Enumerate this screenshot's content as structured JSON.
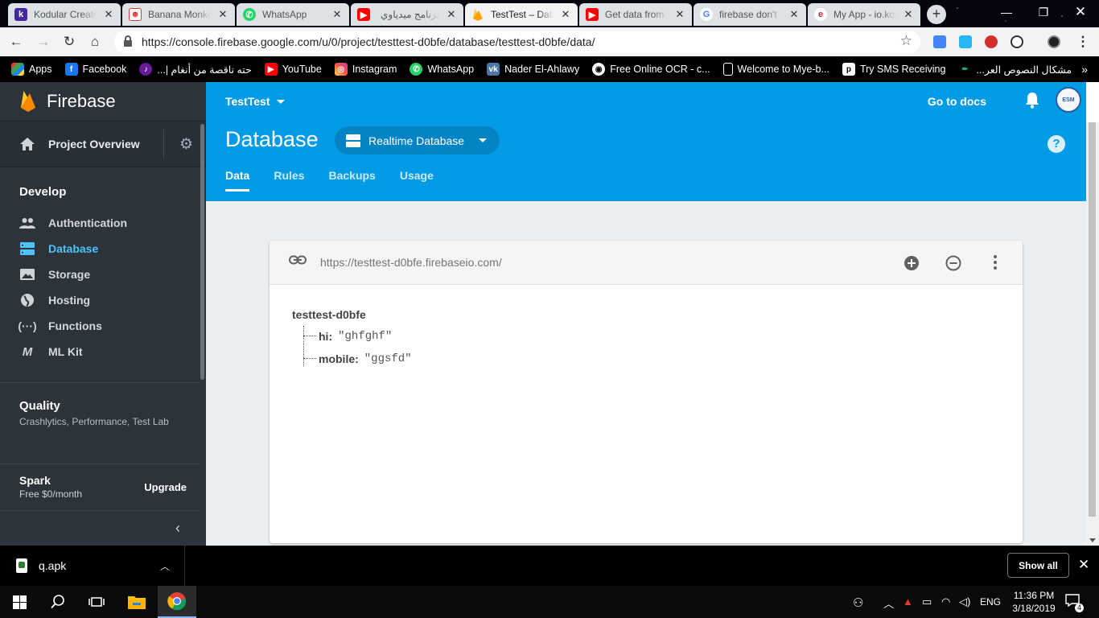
{
  "browser": {
    "tabs": [
      {
        "title": "Kodular Creator",
        "favicon": "K",
        "color": "#4527a0",
        "active": false
      },
      {
        "title": "Banana Monkey",
        "favicon": "B",
        "color": "#e53935",
        "active": false
      },
      {
        "title": "WhatsApp",
        "favicon": "W",
        "color": "#25d366",
        "active": false
      },
      {
        "title": "برنامج ميدياوي",
        "favicon": "Y",
        "color": "#ff0000",
        "active": false
      },
      {
        "title": "TestTest – Database",
        "favicon": "F",
        "color": "#ffa000",
        "active": true
      },
      {
        "title": "Get data from Firebase",
        "favicon": "Y",
        "color": "#ff0000",
        "active": false
      },
      {
        "title": "firebase don't",
        "favicon": "G",
        "color": "#4285f4",
        "active": false
      },
      {
        "title": "My App - io.kodular",
        "favicon": "e",
        "color": "#c62828",
        "active": false
      }
    ],
    "url": "https://console.firebase.google.com/u/0/project/testtest-d0bfe/database/testtest-d0bfe/data/",
    "bookmarks": [
      {
        "label": "Apps",
        "icon": "apps-grid-icon",
        "color": "#e53935"
      },
      {
        "label": "Facebook",
        "icon": "facebook-icon",
        "color": "#1877f2"
      },
      {
        "label": "حته ناقصة من أنغام |...",
        "icon": "music-icon",
        "color": "#6a1b9a"
      },
      {
        "label": "YouTube",
        "icon": "youtube-icon",
        "color": "#ff0000"
      },
      {
        "label": "Instagram",
        "icon": "instagram-icon",
        "color": "#c13584"
      },
      {
        "label": "WhatsApp",
        "icon": "whatsapp-icon",
        "color": "#25d366"
      },
      {
        "label": "Nader El-Ahlawy",
        "icon": "vk-icon",
        "color": "#4a76a8"
      },
      {
        "label": "Free Online OCR - c...",
        "icon": "ocr-icon",
        "color": "#ffffff"
      },
      {
        "label": "Welcome to Mye-b...",
        "icon": "page-icon",
        "color": "#ffffff"
      },
      {
        "label": "Try SMS Receiving",
        "icon": "sms-icon",
        "color": "#ffffff"
      },
      {
        "label": "مشكال النصوص العر...",
        "icon": "mishkal-icon",
        "color": "#26a69a"
      }
    ]
  },
  "sidebar": {
    "brand": "Firebase",
    "overview": "Project Overview",
    "develop_title": "Develop",
    "items": [
      {
        "label": "Authentication",
        "icon": "people-icon",
        "active": false
      },
      {
        "label": "Database",
        "icon": "database-icon",
        "active": true
      },
      {
        "label": "Storage",
        "icon": "storage-icon",
        "active": false
      },
      {
        "label": "Hosting",
        "icon": "globe-icon",
        "active": false
      },
      {
        "label": "Functions",
        "icon": "functions-icon",
        "active": false
      },
      {
        "label": "ML Kit",
        "icon": "ml-kit-icon",
        "active": false
      }
    ],
    "quality_title": "Quality",
    "quality_sub": "Crashlytics, Performance, Test Lab",
    "plan": "Spark",
    "plan_price": "Free $0/month",
    "upgrade": "Upgrade"
  },
  "header": {
    "project": "TestTest",
    "docs": "Go to docs",
    "title": "Database",
    "db_type": "Realtime Database",
    "tabs": [
      "Data",
      "Rules",
      "Backups",
      "Usage"
    ],
    "active_tab": "Data"
  },
  "database": {
    "url": "https://testtest-d0bfe.firebaseio.com/",
    "root": "testtest-d0bfe",
    "nodes": [
      {
        "key": "hi:",
        "value": "\"ghfghf\""
      },
      {
        "key": "mobile:",
        "value": "\"ggsfd\""
      }
    ]
  },
  "downloads": {
    "file": "q.apk",
    "show_all": "Show all"
  },
  "taskbar": {
    "lang": "ENG",
    "time": "11:36 PM",
    "date": "3/18/2019",
    "notifications": "4"
  },
  "colors": {
    "firebase_blue": "#039be5",
    "sidebar_bg": "#2c333a",
    "active_item": "#4fc3f7"
  }
}
